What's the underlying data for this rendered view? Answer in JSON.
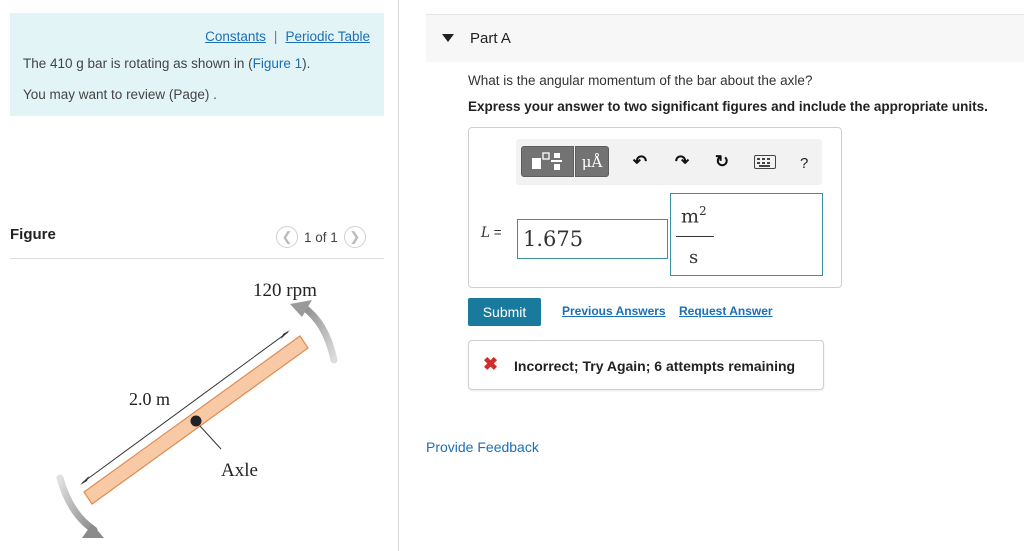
{
  "intro": {
    "constants_link": "Constants",
    "separator": "|",
    "periodic_table_link": "Periodic Table",
    "line1_prefix": "The 410  g bar is rotating as shown in (",
    "line1_link": "Figure 1",
    "line1_suffix": ").",
    "line2": "You may want to review (Page) ."
  },
  "figure": {
    "label": "Figure",
    "pager_text": "1 of 1",
    "rpm_label": "120 rpm",
    "length_label": "2.0 m",
    "axle_label": "Axle"
  },
  "part": {
    "title": "Part A",
    "question": "What is the angular momentum of the bar about the axle?",
    "instruction": "Express your answer to two significant figures and include the appropriate units."
  },
  "answer": {
    "toolbar_units_label": "μÅ",
    "help_label": "?",
    "variable_symbol": "L",
    "equals": " =",
    "value": "1.675",
    "unit_numerator": "m",
    "unit_exponent": "2",
    "unit_denominator": "s"
  },
  "actions": {
    "submit_label": "Submit",
    "previous_answers": "Previous Answers",
    "request_answer": "Request Answer"
  },
  "feedback": {
    "icon": "✖",
    "message": "Incorrect; Try Again; 6 attempts remaining"
  },
  "footer": {
    "provide_feedback": "Provide Feedback"
  },
  "colors": {
    "intro_bg": "#e3f4f7",
    "link": "#1a6fb5",
    "submit_bg": "#1a7a9e",
    "input_border": "#3a8fa0",
    "error": "#d02c2c",
    "bar_fill": "#f8c9a5",
    "bar_stroke": "#e08a52"
  }
}
